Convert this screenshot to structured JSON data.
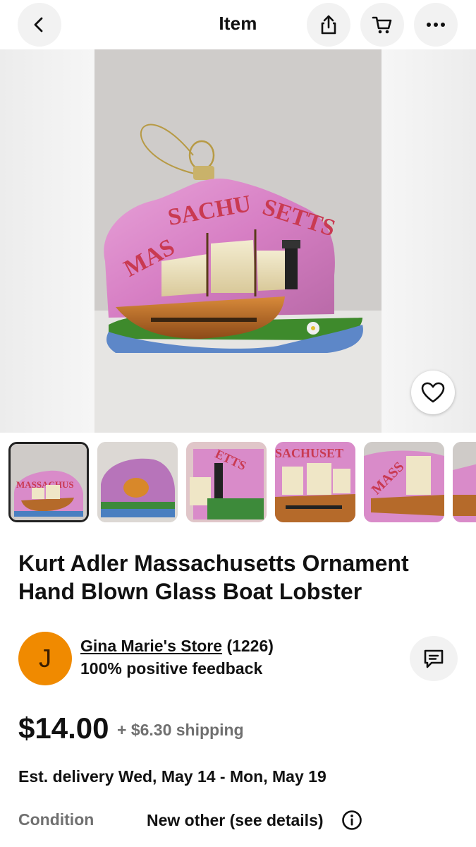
{
  "header": {
    "title": "Item",
    "back_icon": "chevron-left-icon",
    "share_icon": "share-icon",
    "cart_icon": "cart-icon",
    "more_icon": "more-horizontal-icon"
  },
  "hero": {
    "image_text": "MASSACHUSETTS",
    "favorite_icon": "heart-icon"
  },
  "thumbnails": {
    "count_visible": 6,
    "selected_index": 0
  },
  "listing": {
    "title": "Kurt Adler Massachusetts Ornament Hand Blown Glass Boat Lobster"
  },
  "seller": {
    "avatar_letter": "J",
    "avatar_color": "#f08a00",
    "store_name": "Gina Marie's Store",
    "feedback_count": "(1226)",
    "feedback_text": "100% positive feedback",
    "message_icon": "message-icon"
  },
  "pricing": {
    "price": "$14.00",
    "shipping": "+ $6.30 shipping"
  },
  "delivery": {
    "text": "Est. delivery Wed, May 14 - Mon, May 19"
  },
  "condition": {
    "label": "Condition",
    "value": "New other (see details)",
    "info_icon": "info-icon"
  }
}
